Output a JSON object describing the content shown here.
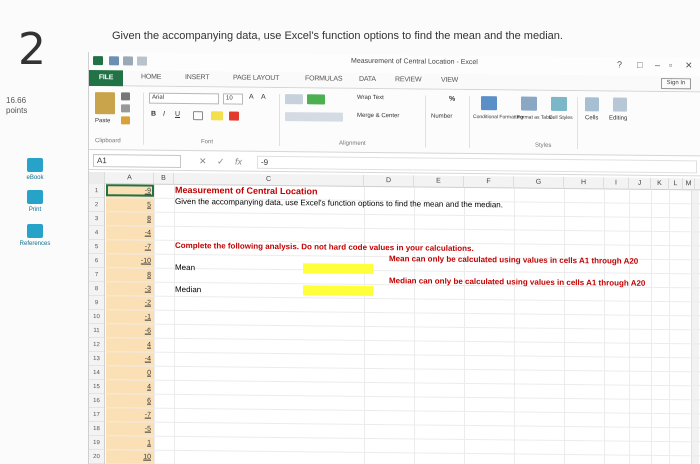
{
  "page": {
    "question_number": "2",
    "prompt": "Given the accompanying data, use Excel's function options to find the mean and the median.",
    "points_value": "16.66",
    "points_label": "points",
    "sidebar": [
      {
        "label": "eBook",
        "icon": "book-icon"
      },
      {
        "label": "Print",
        "icon": "print-icon"
      },
      {
        "label": "References",
        "icon": "references-icon"
      }
    ]
  },
  "excel": {
    "window_title": "Measurement of Central Location - Excel",
    "window_controls": [
      "?",
      "□",
      "–",
      "▫",
      "✕"
    ],
    "tabs": [
      "FILE",
      "HOME",
      "INSERT",
      "PAGE LAYOUT",
      "FORMULAS",
      "DATA",
      "REVIEW",
      "VIEW"
    ],
    "sign_in": "Sign In",
    "ribbon": {
      "paste": "Paste",
      "font_name": "Arial",
      "font_size": "10",
      "bold": "B",
      "italic": "I",
      "underline": "U",
      "wrap_text": "Wrap Text",
      "merge_center": "Merge & Center",
      "number_format": "Number",
      "percent": "%",
      "conditional_formatting": "Conditional Formatting",
      "format_as_table": "Format as Table",
      "cell_styles": "Cell Styles",
      "cells": "Cells",
      "editing": "Editing",
      "groups": [
        "Clipboard",
        "Font",
        "Alignment",
        "Styles"
      ]
    },
    "name_box": "A1",
    "formula_value": "-9",
    "columns": [
      "A",
      "B",
      "C",
      "D",
      "E",
      "F",
      "G",
      "H",
      "I",
      "J",
      "K",
      "L",
      "M"
    ],
    "rows": [
      "1",
      "2",
      "3",
      "4",
      "5",
      "6",
      "7",
      "8",
      "9",
      "10",
      "11",
      "12",
      "13",
      "14",
      "15",
      "16",
      "17",
      "18",
      "19",
      "20"
    ],
    "col_a": [
      "-9",
      "5",
      "8",
      "-4",
      "-7",
      "-10",
      "8",
      "-3",
      "-2",
      "-1",
      "-6",
      "4",
      "-4",
      "0",
      "4",
      "6",
      "-7",
      "-5",
      "1",
      "10"
    ],
    "cells": {
      "c1": "Measurement of Central Location",
      "c2": "Given the accompanying data, use Excel's function options to find the mean and the median.",
      "c6": "Complete the following analysis. Do not hard code values in your calculations.",
      "c8": "Mean",
      "c10": "Median",
      "f7": "Mean can only be calculated using values in cells A1 through A20",
      "f9": "Median can only be calculated using values in cells A1 through A20"
    }
  }
}
